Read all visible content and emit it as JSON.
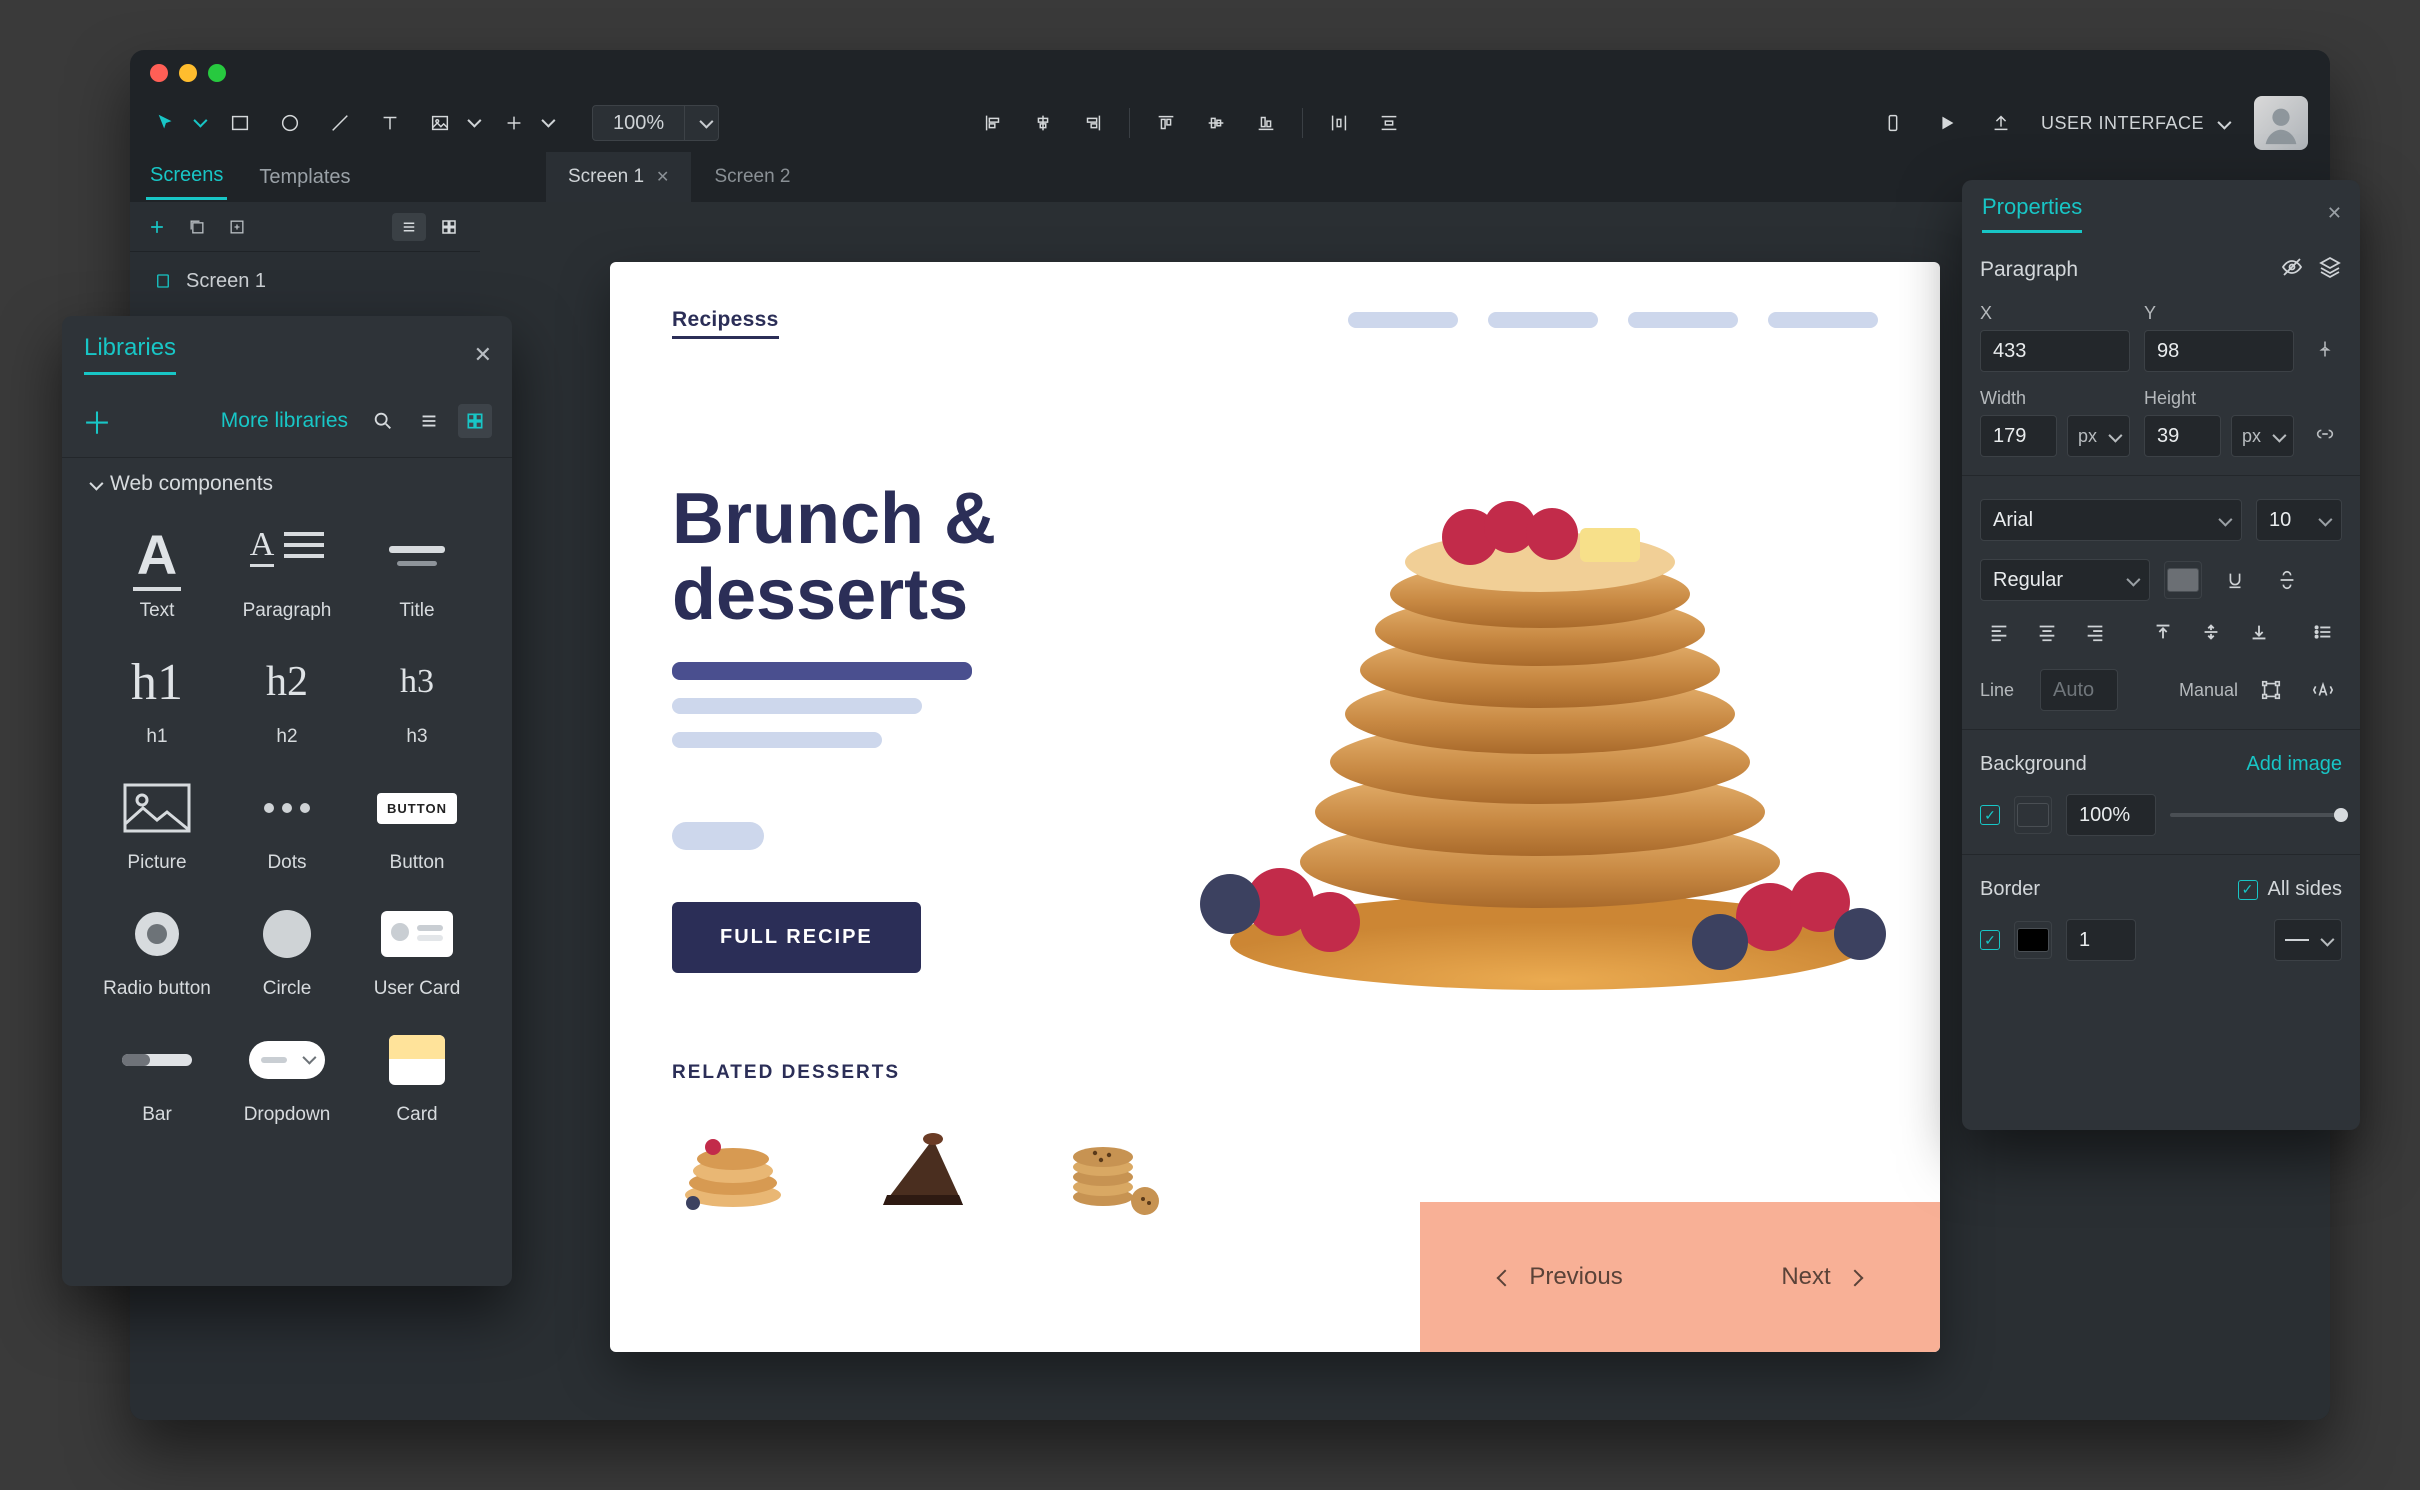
{
  "toolbar": {
    "zoom": "100%",
    "workspace_label": "USER INTERFACE"
  },
  "left_tabs": {
    "screens": "Screens",
    "templates": "Templates"
  },
  "doc_tabs": [
    "Screen 1",
    "Screen 2"
  ],
  "screens_list": [
    "Screen 1",
    "Screen 2"
  ],
  "libraries": {
    "title": "Libraries",
    "more": "More libraries",
    "section": "Web components",
    "components": [
      {
        "key": "text",
        "label": "Text"
      },
      {
        "key": "paragraph",
        "label": "Paragraph"
      },
      {
        "key": "title",
        "label": "Title"
      },
      {
        "key": "h1",
        "label": "h1"
      },
      {
        "key": "h2",
        "label": "h2"
      },
      {
        "key": "h3",
        "label": "h3"
      },
      {
        "key": "picture",
        "label": "Picture"
      },
      {
        "key": "dots",
        "label": "Dots"
      },
      {
        "key": "button",
        "label": "Button",
        "chip": "BUTTON"
      },
      {
        "key": "radio",
        "label": "Radio button"
      },
      {
        "key": "circle",
        "label": "Circle"
      },
      {
        "key": "usercard",
        "label": "User Card"
      },
      {
        "key": "bar",
        "label": "Bar"
      },
      {
        "key": "dropdown",
        "label": "Dropdown"
      },
      {
        "key": "card",
        "label": "Card"
      }
    ]
  },
  "artboard": {
    "brand": "Recipesss",
    "headline_l1": "Brunch &",
    "headline_l2": "desserts",
    "cta": "FULL RECIPE",
    "related": "RELATED DESSERTS",
    "prev": "Previous",
    "next": "Next"
  },
  "properties": {
    "title": "Properties",
    "element": "Paragraph",
    "x_label": "X",
    "x": "433",
    "y_label": "Y",
    "y": "98",
    "width_label": "Width",
    "width": "179",
    "height_label": "Height",
    "height": "39",
    "unit": "px",
    "font_family": "Arial",
    "font_size": "10",
    "font_weight": "Regular",
    "line_label": "Line",
    "line_auto": "Auto",
    "manual_label": "Manual",
    "background_label": "Background",
    "add_image": "Add image",
    "bg_color": "#ffffff",
    "bg_opacity": "100%",
    "border_label": "Border",
    "all_sides": "All sides",
    "border_color": "#000000",
    "border_width": "1"
  }
}
